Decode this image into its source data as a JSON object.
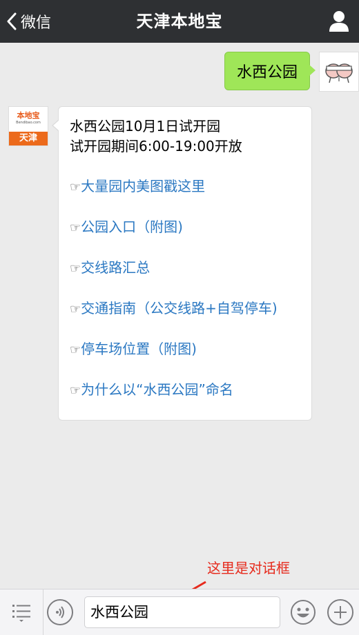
{
  "header": {
    "back_label": "微信",
    "title": "天津本地宝"
  },
  "my_message": {
    "text": "水西公园"
  },
  "bot": {
    "avatar_brand": "本地宝",
    "avatar_domain": "Bendibao.com",
    "avatar_city": "天津"
  },
  "bot_message": {
    "line1": "水西公园10月1日试开园",
    "line2": "试开园期间6:00-19:00开放",
    "links": [
      {
        "hand": "☞",
        "label": "大量园内美图戳这里"
      },
      {
        "hand": "☞",
        "label": "公园入口（附图)"
      },
      {
        "hand": "☞",
        "label": "交线路汇总"
      },
      {
        "hand": "☞",
        "label": "交通指南（公交线路+自驾停车)"
      },
      {
        "hand": "☞",
        "label": "停车场位置（附图)"
      },
      {
        "hand": "☞",
        "label": "为什么以“水西公园”命名"
      }
    ]
  },
  "annotation": {
    "text": "这里是对话框"
  },
  "input_bar": {
    "value": "水西公园"
  },
  "colors": {
    "topbar": "#2e3033",
    "my_bubble": "#9fe658",
    "link": "#2b78c2",
    "annotation": "#e62a1c",
    "brand_orange": "#ec6a1b"
  }
}
